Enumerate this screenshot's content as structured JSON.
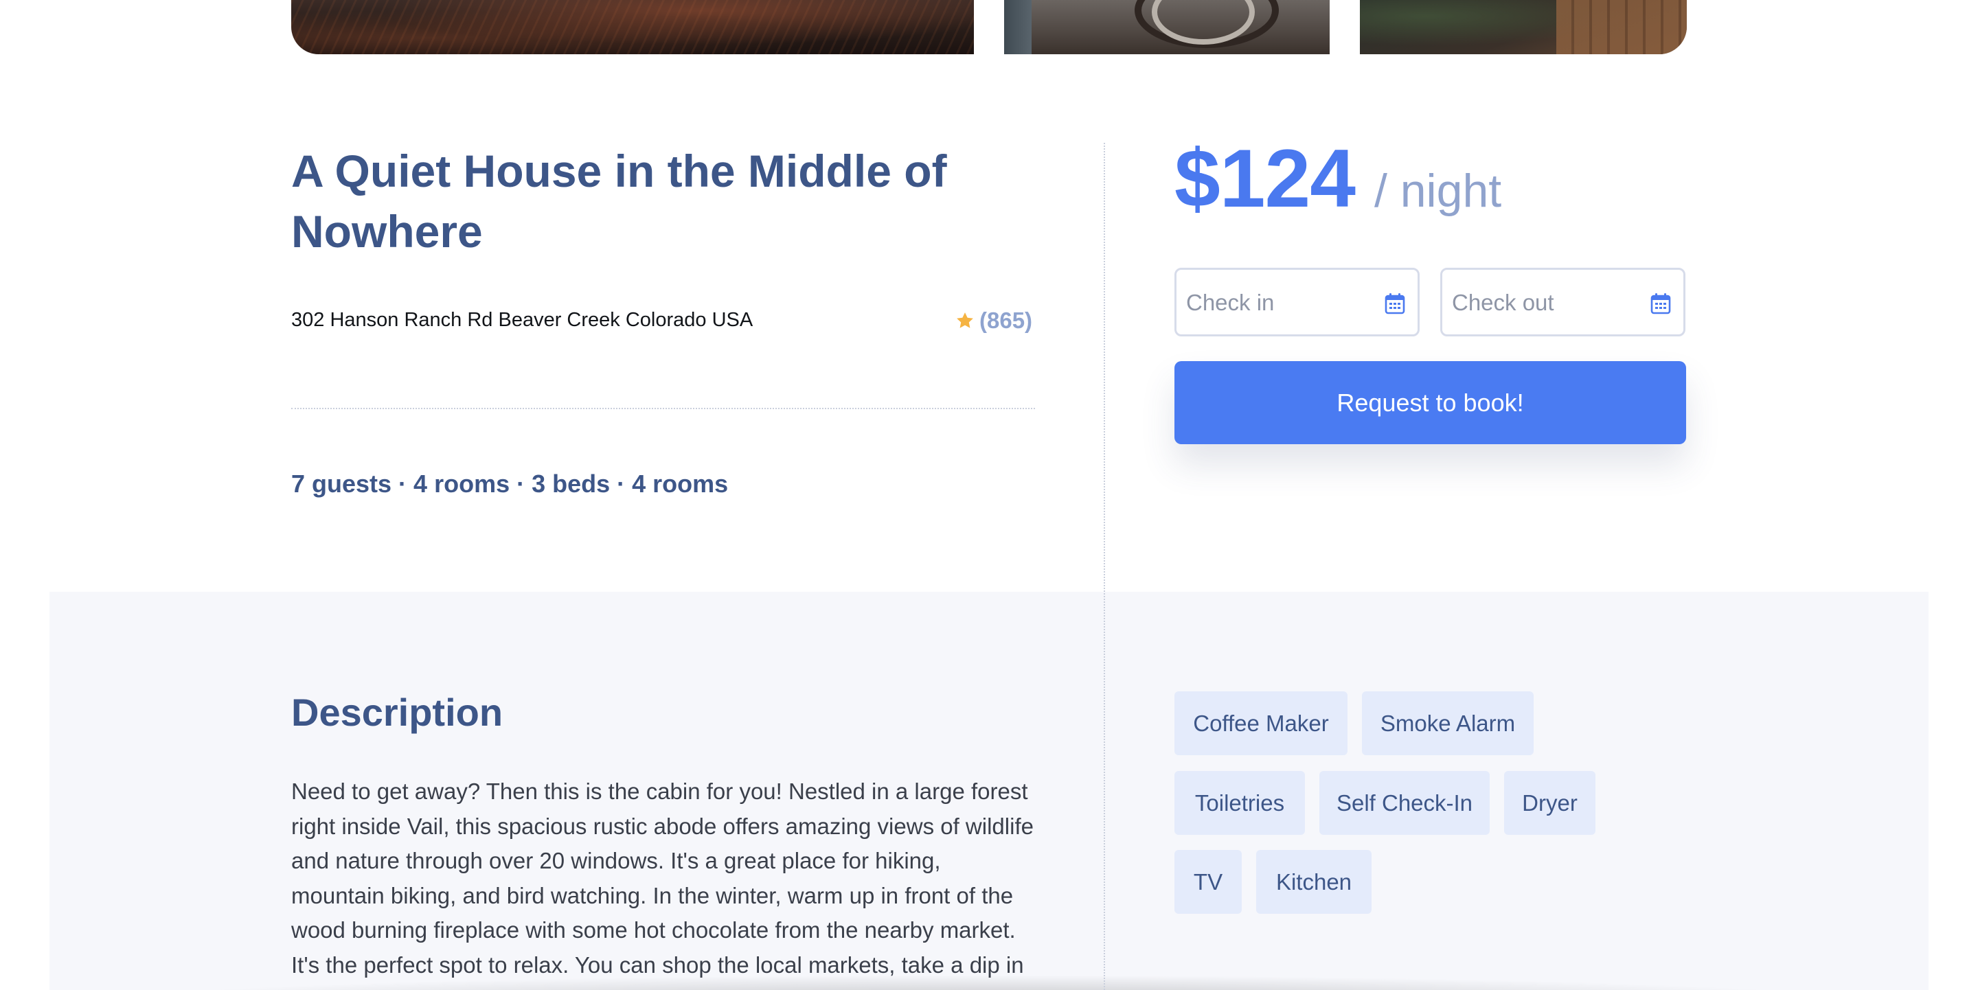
{
  "listing": {
    "title": "A Quiet House in the Middle of Nowhere",
    "address": "302 Hanson Ranch Rd Beaver Creek Colorado USA",
    "rating_count": "(865)",
    "stats": "7 guests · 4 rooms · 3 beds · 4 rooms"
  },
  "booking": {
    "price": "$124",
    "per_night": "/ night",
    "checkin_placeholder": "Check in",
    "checkout_placeholder": "Check out",
    "book_label": "Request to book!"
  },
  "description": {
    "heading": "Description",
    "body": "Need to get away? Then this is the cabin for you! Nestled in a large forest right inside Vail, this spacious rustic abode offers amazing views of wildlife and nature through over 20 windows. It's a great place for hiking, mountain biking, and bird watching. In the winter, warm up in front of the wood burning fireplace with some hot chocolate from the nearby market. It's the perfect spot to relax. You can shop the local markets, take a dip in the hot"
  },
  "amenities": [
    "Coffee Maker",
    "Smoke Alarm",
    "Toiletries",
    "Self Check-In",
    "Dryer",
    "TV",
    "Kitchen"
  ],
  "colors": {
    "accent": "#4a7bf2",
    "title": "#3d5688",
    "muted": "#90a3cd",
    "chip_bg": "#e4ebfb",
    "star": "#f5b342"
  },
  "icons": {
    "rating": "star-icon",
    "date": "calendar-icon"
  }
}
